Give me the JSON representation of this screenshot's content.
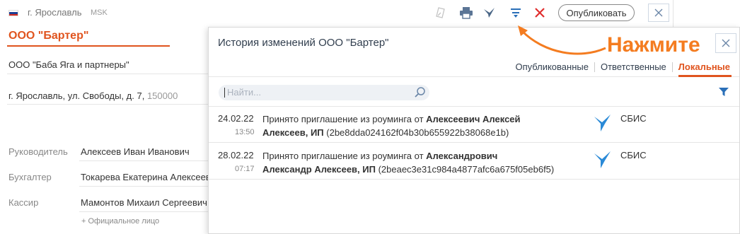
{
  "header": {
    "city": "г. Ярославль",
    "timezone": "MSK",
    "publish_label": "Опубликовать",
    "colors": {
      "accent": "#e0541e",
      "annotation": "#f47c20",
      "brand_blue": "#2a8ad7",
      "delete_red": "#e02d2d"
    }
  },
  "company": {
    "name": "ООО \"Бартер\"",
    "partner": "ООО \"Баба Яга и партнеры\"",
    "address": "г. Ярославль, ул. Свободы, д. 7,",
    "postcode": "150000"
  },
  "people": [
    {
      "label": "Руководитель",
      "value": "Алексеев Иван Иванович"
    },
    {
      "label": "Бухгалтер",
      "value": "Токарева Екатерина Алексеевна"
    },
    {
      "label": "Кассир",
      "value": "Мамонтов Михаил Сергеевич"
    }
  ],
  "official_label": "+ Официальное лицо",
  "popup": {
    "title": "История изменений ООО \"Бартер\"",
    "tabs": [
      "Опубликованные",
      "Ответственные",
      "Локальные"
    ],
    "active_tab": "Локальные",
    "search_placeholder": "Найти...",
    "rows": [
      {
        "date": "24.02.22",
        "time": "13:50",
        "text_prefix": "Принято приглашение из роуминга от",
        "bold1": "Алексеевич Алексей",
        "bold2": "Алексеев, ИП",
        "guid": "(2be8dda024162f04b30b655922b38068e1b)",
        "source": "СБИС"
      },
      {
        "date": "28.02.22",
        "time": "07:17",
        "text_prefix": "Принято приглашение из роуминга от",
        "bold1": "Александрович",
        "bold2": "Александр Алексеев, ИП",
        "guid": "(2beaec3e31c984a4877afc6a675f05eb6f5)",
        "source": "СБИС"
      }
    ]
  },
  "annotation": {
    "text": "Нажмите"
  }
}
